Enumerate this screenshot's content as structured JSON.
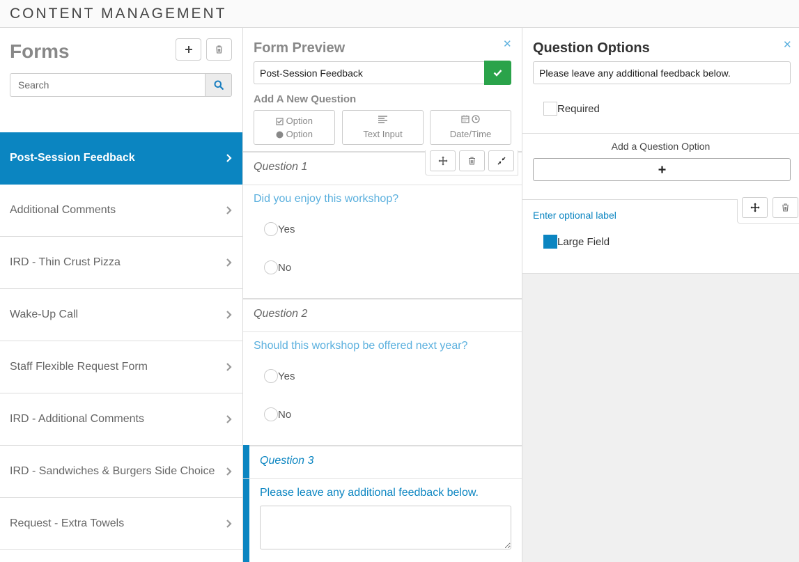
{
  "app": {
    "title": "CONTENT MANAGEMENT"
  },
  "forms_panel": {
    "title": "Forms",
    "add_icon": "plus-icon",
    "delete_icon": "trash-icon",
    "search": {
      "placeholder": "Search",
      "value": "",
      "icon": "search-icon"
    },
    "items": [
      {
        "label": "Post-Session Feedback",
        "active": true
      },
      {
        "label": "Additional Comments",
        "active": false
      },
      {
        "label": "IRD - Thin Crust Pizza",
        "active": false
      },
      {
        "label": "Wake-Up Call",
        "active": false
      },
      {
        "label": "Staff Flexible Request Form",
        "active": false
      },
      {
        "label": "IRD - Additional Comments",
        "active": false
      },
      {
        "label": "IRD - Sandwiches & Burgers Side Choice",
        "active": false
      },
      {
        "label": "Request - Extra Towels",
        "active": false
      }
    ]
  },
  "form_preview": {
    "title": "Form Preview",
    "close_icon": "close-icon",
    "form_name": "Post-Session Feedback",
    "save_icon": "check-icon",
    "add_question_label": "Add A New Question",
    "question_types": {
      "option_checkbox": "Option",
      "option_radio": "Option",
      "text_input": "Text Input",
      "date_time": "Date/Time"
    },
    "questions": [
      {
        "number": "Question 1",
        "text": "Did you enjoy this workshop?",
        "options": [
          "Yes",
          "No"
        ]
      },
      {
        "number": "Question 2",
        "text": "Should this workshop be offered next year?",
        "options": [
          "Yes",
          "No"
        ]
      },
      {
        "number": "Question 3",
        "text": "Please leave any additional feedback below.",
        "type": "textarea",
        "value": ""
      }
    ]
  },
  "question_options": {
    "title": "Question Options",
    "close_icon": "close-icon",
    "question_text": "Please leave any additional feedback below.",
    "required_label": "Required",
    "required_checked": false,
    "add_option_label": "Add a Question Option",
    "add_option_icon": "plus-icon",
    "optional_label_link": "Enter optional label",
    "large_field_label": "Large Field",
    "large_field_checked": true
  },
  "colors": {
    "accent": "#0b85c1",
    "accent_light": "#5bb0de",
    "success": "#2aa34a"
  }
}
